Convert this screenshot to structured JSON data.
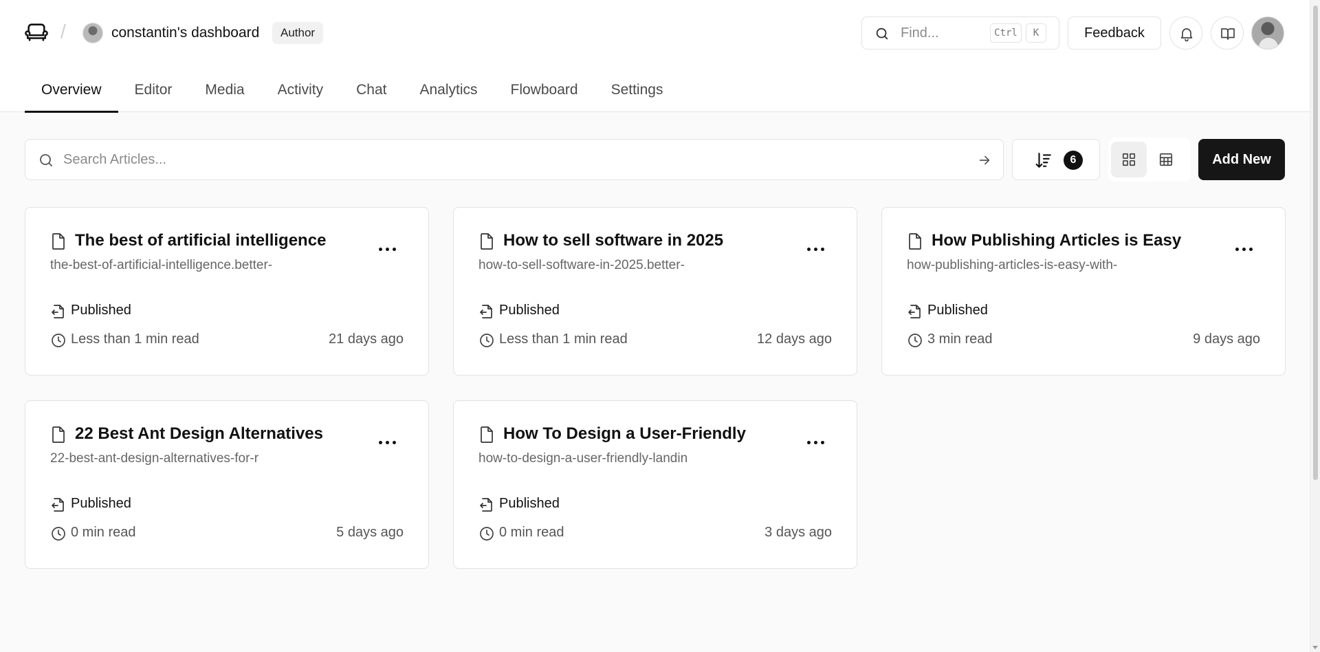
{
  "header": {
    "team_name": "constantin's dashboard",
    "role_badge": "Author",
    "find": {
      "placeholder": "Find...",
      "shortcut_ctrl": "Ctrl",
      "shortcut_key": "K"
    },
    "feedback_label": "Feedback"
  },
  "tabs": [
    {
      "label": "Overview",
      "active": true
    },
    {
      "label": "Editor"
    },
    {
      "label": "Media"
    },
    {
      "label": "Activity"
    },
    {
      "label": "Chat"
    },
    {
      "label": "Analytics"
    },
    {
      "label": "Flowboard"
    },
    {
      "label": "Settings"
    }
  ],
  "toolbar": {
    "search_placeholder": "Search Articles...",
    "sort_count": "6",
    "view_mode": "grid",
    "add_new_label": "Add New"
  },
  "articles": [
    {
      "title": "The best of artificial intelligence",
      "slug": "the-best-of-artificial-intelligence.better-",
      "status": "Published",
      "read_time": "Less than 1 min read",
      "age": "21 days ago"
    },
    {
      "title": "How to sell software in 2025",
      "slug": "how-to-sell-software-in-2025.better-",
      "status": "Published",
      "read_time": "Less than 1 min read",
      "age": "12 days ago"
    },
    {
      "title": "How Publishing Articles is Easy",
      "slug": "how-publishing-articles-is-easy-with-",
      "status": "Published",
      "read_time": "3 min read",
      "age": "9 days ago"
    },
    {
      "title": "22 Best Ant Design Alternatives",
      "slug": "22-best-ant-design-alternatives-for-r",
      "status": "Published",
      "read_time": "0 min read",
      "age": "5 days ago"
    },
    {
      "title": "How To Design a User-Friendly",
      "slug": "how-to-design-a-user-friendly-landin",
      "status": "Published",
      "read_time": "0 min read",
      "age": "3 days ago"
    }
  ]
}
